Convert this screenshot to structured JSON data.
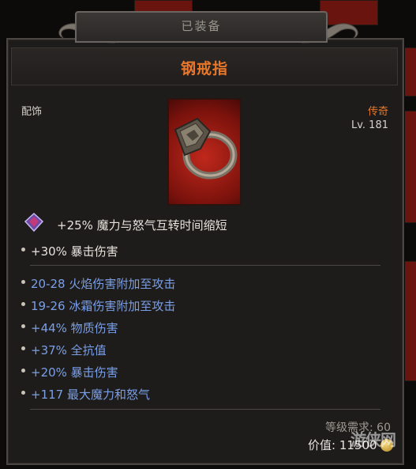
{
  "header": {
    "equipped_label": "已装备"
  },
  "item": {
    "name": "钢戒指",
    "category": "配饰",
    "rarity": "传奇",
    "level": "Lv. 181",
    "image_icon": "steel-ring-icon"
  },
  "implicit": {
    "gem_icon": "gem-icon",
    "text": "+25% 魔力与怒气互转时间缩短"
  },
  "base_stats": [
    "+30% 暴击伤害"
  ],
  "affixes": [
    "20-28 火焰伤害附加至攻击",
    "19-26 冰霜伤害附加至攻击",
    "+44% 物质伤害",
    "+37% 全抗值",
    "+20% 暴击伤害",
    "+117 最大魔力和怒气"
  ],
  "footer": {
    "requirement": "等级需求: 60",
    "price": "价值: 11500",
    "coin_icon": "gold-coin-icon"
  },
  "watermark": "游侠网",
  "colors": {
    "legendary": "#e8772a",
    "affix_blue": "#7a9fe6",
    "text_white": "#e6e2dc"
  }
}
